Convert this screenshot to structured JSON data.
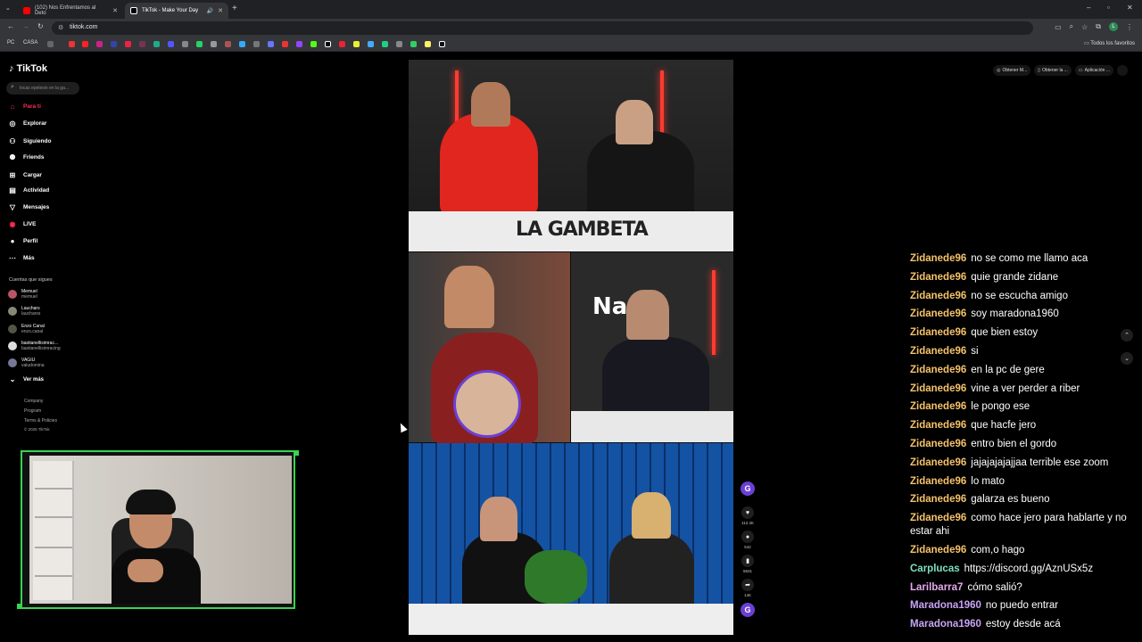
{
  "browser": {
    "tabs": [
      {
        "label": "(102) Nos Enfrentamos al Deto",
        "color": "#ff0000"
      },
      {
        "label": "TikTok - Make Your Day",
        "color": "#ffffff"
      }
    ],
    "url": "tiktok.com",
    "bookmarks": {
      "pc": "PC",
      "casa": "CASA",
      "all": "Todos los favoritos"
    },
    "profile_initial": "L"
  },
  "tiktok": {
    "logo": "TikTok",
    "search_placeholder": "locas epelesin en la ga...",
    "nav": [
      {
        "label": "Para ti",
        "icon": "home-icon"
      },
      {
        "label": "Explorar",
        "icon": "compass-icon"
      },
      {
        "label": "Siguiendo",
        "icon": "following-icon"
      },
      {
        "label": "Friends",
        "icon": "friends-icon"
      },
      {
        "label": "Cargar",
        "icon": "upload-icon"
      },
      {
        "label": "Actividad",
        "icon": "activity-icon"
      },
      {
        "label": "Mensajes",
        "icon": "messages-icon"
      },
      {
        "label": "LIVE",
        "icon": "live-icon"
      },
      {
        "label": "Perfil",
        "icon": "profile-icon"
      },
      {
        "label": "Más",
        "icon": "more-icon"
      }
    ],
    "following_title": "Cuentas que sigues",
    "following": [
      {
        "name": "Memuel",
        "handle": "memuel"
      },
      {
        "name": "Lauchars",
        "handle": "laucharss"
      },
      {
        "name": "Enzo Canal",
        "handle": "enzo.canal"
      },
      {
        "name": "bastianellisimrac...",
        "handle": "bastianellisimracing"
      },
      {
        "name": "VAGIU",
        "handle": "valudomina"
      }
    ],
    "see_more": "Ver más",
    "footer": [
      "Company",
      "Program",
      "Terms & Policies",
      "© 2025 TikTok"
    ],
    "top_right": [
      "Obtener M...",
      "Obtener la ...",
      "Aplicación ..."
    ],
    "actions": {
      "likes": "112.2K",
      "comments": "542",
      "saves": "5631",
      "shares": "14K"
    },
    "video": {
      "brand": "LA GAMBETA",
      "creator_initial": "G",
      "na_logo": "Na"
    }
  },
  "chat": [
    {
      "user": "Zidanede96",
      "text": "no se como me llamo aca",
      "color": "#f5c26b"
    },
    {
      "user": "Zidanede96",
      "text": "quie grande zidane",
      "color": "#f5c26b"
    },
    {
      "user": "Zidanede96",
      "text": "no se escucha amigo",
      "color": "#f5c26b"
    },
    {
      "user": "Zidanede96",
      "text": "soy maradona1960",
      "color": "#f5c26b"
    },
    {
      "user": "Zidanede96",
      "text": "que bien estoy",
      "color": "#f5c26b"
    },
    {
      "user": "Zidanede96",
      "text": "si",
      "color": "#f5c26b"
    },
    {
      "user": "Zidanede96",
      "text": "en la pc de gere",
      "color": "#f5c26b"
    },
    {
      "user": "Zidanede96",
      "text": "vine a ver perder a riber",
      "color": "#f5c26b"
    },
    {
      "user": "Zidanede96",
      "text": "le pongo ese",
      "color": "#f5c26b"
    },
    {
      "user": "Zidanede96",
      "text": "que hacfe jero",
      "color": "#f5c26b"
    },
    {
      "user": "Zidanede96",
      "text": "entro bien el gordo",
      "color": "#f5c26b"
    },
    {
      "user": "Zidanede96",
      "text": "jajajajajajjaa terrible ese zoom",
      "color": "#f5c26b"
    },
    {
      "user": "Zidanede96",
      "text": "lo mato",
      "color": "#f5c26b"
    },
    {
      "user": "Zidanede96",
      "text": "galarza es bueno",
      "color": "#f5c26b"
    },
    {
      "user": "Zidanede96",
      "text": "como hace jero para hablarte y no estar ahi",
      "color": "#f5c26b"
    },
    {
      "user": "Zidanede96",
      "text": "com,o hago",
      "color": "#f5c26b"
    },
    {
      "user": "Carplucas",
      "text": "https://discord.gg/AznUSx5z",
      "color": "#7fe0c0"
    },
    {
      "user": "Larilbarra7",
      "text": "cómo salió?",
      "color": "#e8a8f0"
    },
    {
      "user": "Maradona1960",
      "text": "no puedo entrar",
      "color": "#c9a3f5"
    },
    {
      "user": "Maradona1960",
      "text": "estoy desde acá",
      "color": "#c9a3f5"
    }
  ]
}
